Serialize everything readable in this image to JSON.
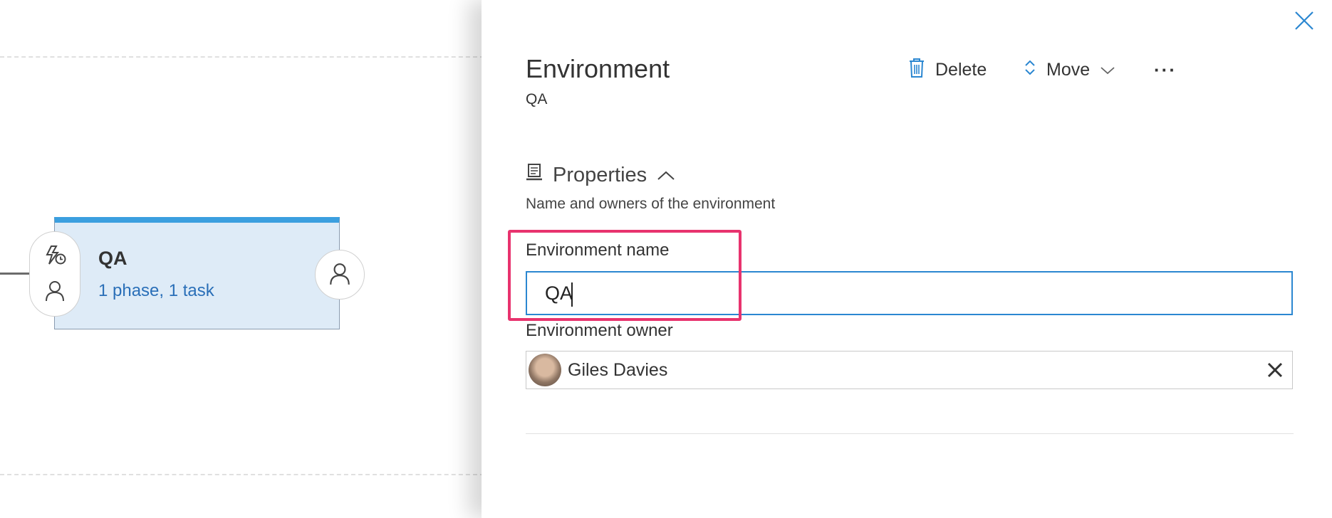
{
  "stage": {
    "title": "QA",
    "summary": "1 phase, 1 task"
  },
  "panel": {
    "title": "Environment",
    "subtitle": "QA",
    "toolbar": {
      "delete_label": "Delete",
      "move_label": "Move",
      "more_label": "···"
    },
    "properties": {
      "header": "Properties",
      "description": "Name and owners of the environment",
      "name_label": "Environment name",
      "name_value": "QA",
      "owner_label": "Environment owner",
      "owner_name": "Giles Davies"
    }
  },
  "colors": {
    "accent": "#2b87d1",
    "card_top": "#3b9fdf",
    "card_bg": "#deebf7",
    "highlight": "#e8336e",
    "link": "#2a6fb8"
  },
  "icons": {
    "close": "close-icon",
    "delete": "trash-icon",
    "move": "up-down-arrows-icon",
    "move_dropdown": "chevron-down-icon",
    "properties": "properties-icon",
    "collapse": "chevron-up-icon",
    "pre_trigger": "lightning-schedule-icon",
    "pre_approver": "person-icon",
    "post_approver": "person-icon",
    "remove_owner": "close-icon"
  }
}
